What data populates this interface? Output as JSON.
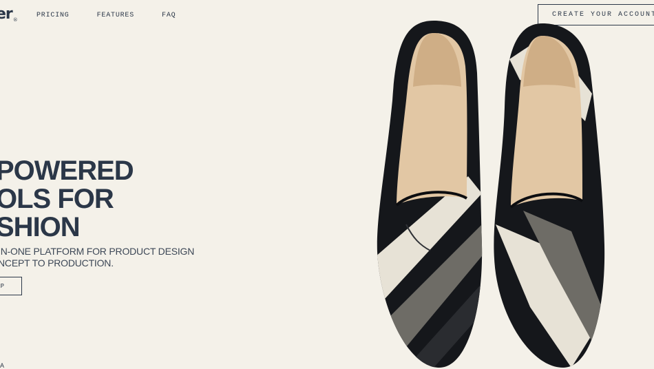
{
  "brand": {
    "logo_text": "er",
    "logo_mark": "®"
  },
  "nav": {
    "items": [
      "PRICING",
      "FEATURES",
      "FAQ"
    ]
  },
  "header": {
    "cta_label": "CREATE YOUR ACCOUNT"
  },
  "hero": {
    "headline_lines": [
      "POWERED",
      "OLS FOR",
      "SHION"
    ],
    "subtitle_lines": [
      "IN-ONE PLATFORM FOR PRODUCT DESIGN",
      "NCEPT TO PRODUCTION."
    ],
    "button_label": "P",
    "corner_text": "A"
  },
  "colors": {
    "background": "#f4f1e9",
    "ink": "#2b3748",
    "leather_black": "#15171b",
    "stripe_cream": "#e7e2d6",
    "stripe_grey": "#6e6c66",
    "lining": "#e2c7a4"
  },
  "icons": {
    "hero_image": "loafer-shoes-image"
  }
}
